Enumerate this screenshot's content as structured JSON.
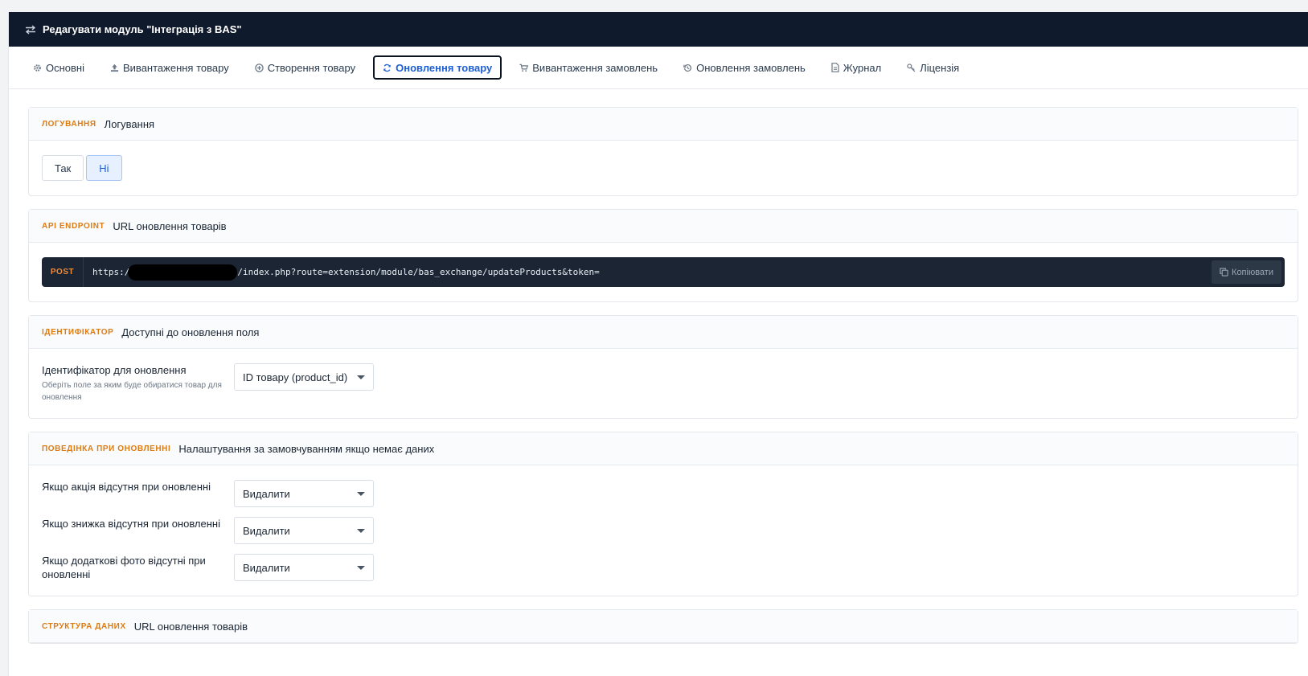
{
  "header": {
    "title": "Редагувати модуль \"Інтеграція з BAS\""
  },
  "tabs": [
    {
      "label": "Основні",
      "icon": "gear-icon"
    },
    {
      "label": "Вивантаження товару",
      "icon": "upload-icon"
    },
    {
      "label": "Створення товару",
      "icon": "plus-circle-icon"
    },
    {
      "label": "Оновлення товару",
      "icon": "refresh-icon",
      "active": true
    },
    {
      "label": "Вивантаження замовлень",
      "icon": "cart-icon"
    },
    {
      "label": "Оновлення замовлень",
      "icon": "history-icon"
    },
    {
      "label": "Журнал",
      "icon": "document-icon"
    },
    {
      "label": "Ліцензія",
      "icon": "key-icon"
    }
  ],
  "logging": {
    "badge": "ЛОГУВАННЯ",
    "title": "Логування",
    "options": [
      "Так",
      "Ні"
    ],
    "selected": "Ні"
  },
  "endpoint": {
    "badge": "API ENDPOINT",
    "title": "URL оновлення товарів",
    "method": "POST",
    "url_prefix": "https:/",
    "url_suffix": "/index.php?route=extension/module/bas_exchange/updateProducts&token=",
    "copy_label": "Копіювати"
  },
  "identifier": {
    "badge": "ІДЕНТИФІКАТОР",
    "title": "Доступні до оновлення поля",
    "field_label": "Ідентифікатор для оновлення",
    "field_help": "Оберіть поле за яким буде обиратися товар для оновлення",
    "value": "ID товару (product_id)"
  },
  "behavior": {
    "badge": "ПОВЕДІНКА ПРИ ОНОВЛЕННІ",
    "title": "Налаштування за замовчуванням якщо немає даних",
    "rows": [
      {
        "label": "Якщо акція відсутня при оновленні",
        "value": "Видалити"
      },
      {
        "label": "Якщо знижка відсутня при оновленні",
        "value": "Видалити"
      },
      {
        "label": "Якщо додаткові фото відсутні при оновленні",
        "value": "Видалити"
      }
    ]
  },
  "structure": {
    "badge": "СТРУКТУРА ДАНИХ",
    "title": "URL оновлення товарів"
  },
  "colors": {
    "header_bg": "#0f1a2c",
    "accent_blue": "#1d5fd6",
    "badge_orange": "#de7b10",
    "code_bg": "#1b2534"
  }
}
